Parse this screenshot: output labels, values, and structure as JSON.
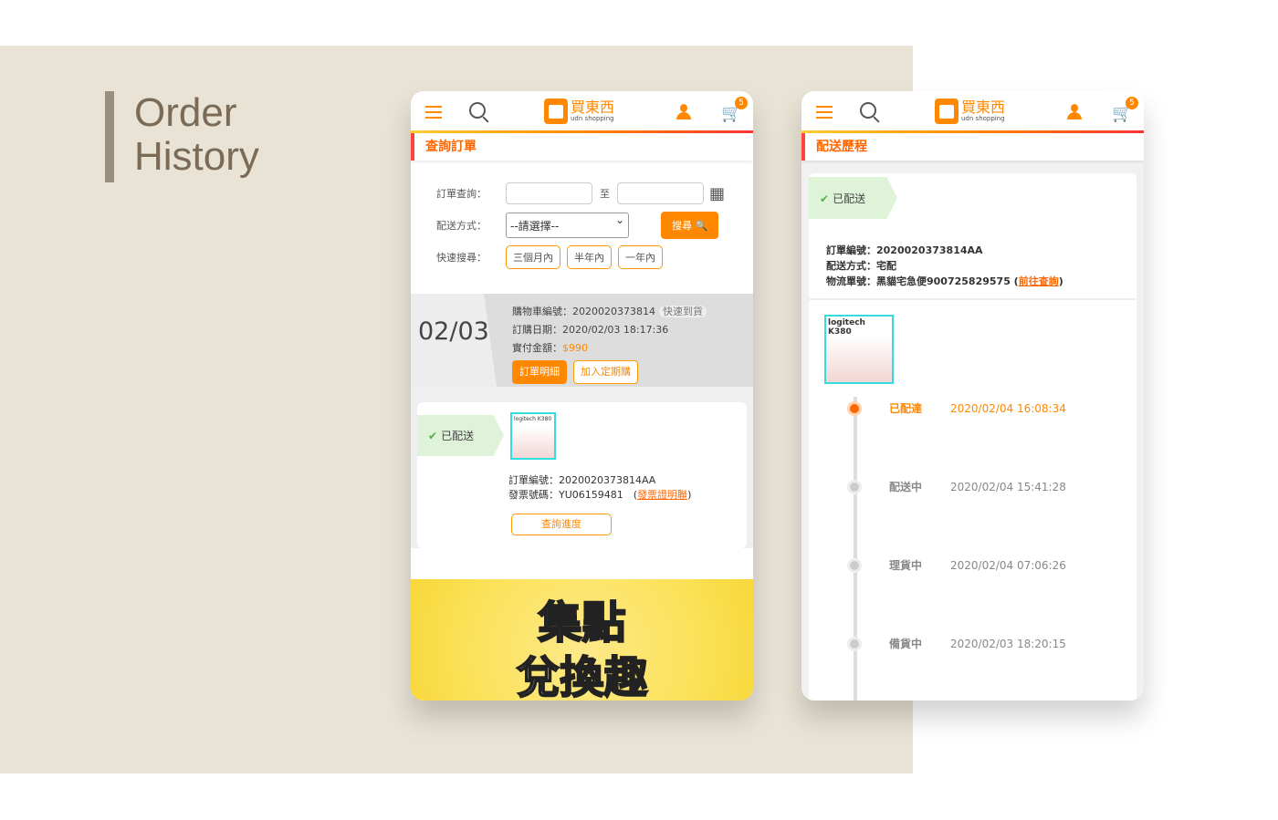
{
  "heading": {
    "line1": "Order",
    "line2": "History"
  },
  "header": {
    "brand": "買東西",
    "brand_sub": "udn shopping",
    "cart_count": "5",
    "cart_icon": "🛒"
  },
  "query": {
    "title": "查詢訂單",
    "order_label": "訂單查詢：",
    "to": "至",
    "ship_label": "配送方式：",
    "ship_value": "--請選擇--",
    "search_btn": "搜尋 🔍",
    "quick_label": "快速搜尋：",
    "quick": [
      "三個月內",
      "半年內",
      "一年內"
    ]
  },
  "order": {
    "date": "02/03",
    "cart_no": "購物車編號：2020020373814",
    "fast_tag": "快速到貨",
    "order_date": "訂購日期：2020/02/03 18:17:36",
    "paid_label": "實付金額：",
    "paid": "$990",
    "detail_btn": "訂單明細",
    "subscribe_btn": "加入定期購",
    "status": "已配送",
    "order_no": "訂單編號：2020020373814AA",
    "invoice": "發票號碼：YU06159481　(",
    "invoice_link": "發票證明聯",
    "invoice_end": ")",
    "progress_btn": "查詢進度",
    "product_brand": "logitech K380"
  },
  "banner": {
    "line1": "集點",
    "line2": "兌換趣"
  },
  "history": {
    "title": "配送歷程",
    "status": "已配送",
    "order_no": "訂單編號：2020020373814AA",
    "ship": "配送方式：宅配",
    "tracking": "物流單號：黑貓宅急便900725829575 (",
    "tracking_link": "前往查詢",
    "tracking_end": ")",
    "product_brand": "logitech K380",
    "steps": [
      {
        "status": "已配達",
        "time": "2020/02/04 16:08:34"
      },
      {
        "status": "配送中",
        "time": "2020/02/04 15:41:28"
      },
      {
        "status": "理貨中",
        "time": "2020/02/04 07:06:26"
      },
      {
        "status": "備貨中",
        "time": "2020/02/03 18:20:15"
      }
    ]
  }
}
